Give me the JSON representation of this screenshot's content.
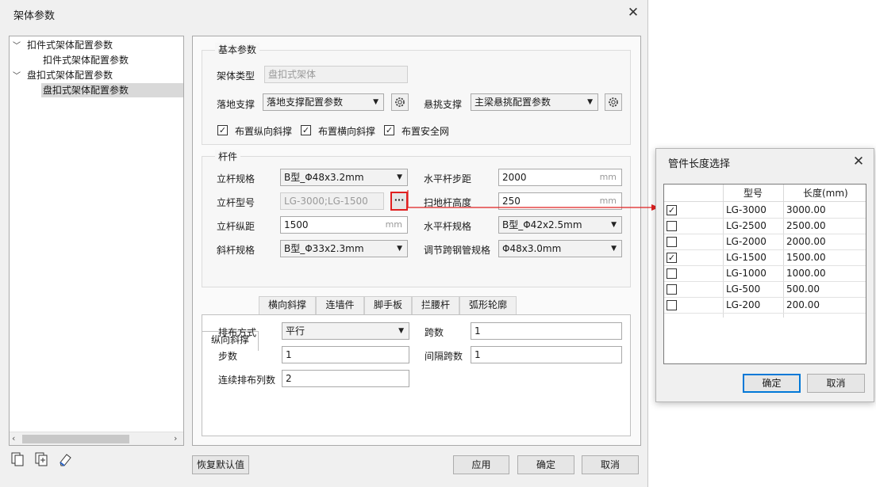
{
  "window": {
    "title": "架体参数"
  },
  "tree": {
    "items": [
      {
        "label": "扣件式架体配置参数",
        "expanded": true
      },
      {
        "label": "扣件式架体配置参数"
      },
      {
        "label": "盘扣式架体配置参数",
        "expanded": true
      },
      {
        "label": "盘扣式架体配置参数",
        "selected": true
      }
    ]
  },
  "basic": {
    "group_title": "基本参数",
    "frame_type_label": "架体类型",
    "frame_type_value": "盘扣式架体",
    "ground_support_label": "落地支撑",
    "ground_support_value": "落地支撑配置参数",
    "cantilever_label": "悬挑支撑",
    "cantilever_value": "主梁悬挑配置参数",
    "checks": [
      {
        "label": "布置纵向斜撑",
        "checked": true
      },
      {
        "label": "布置横向斜撑",
        "checked": true
      },
      {
        "label": "布置安全网",
        "checked": true
      }
    ]
  },
  "members": {
    "group_title": "杆件",
    "pole_spec_label": "立杆规格",
    "pole_spec_value": "B型_Φ48x3.2mm",
    "pole_model_label": "立杆型号",
    "pole_model_value": "LG-3000;LG-1500",
    "pole_model_button": "···",
    "pole_spacing_label": "立杆纵距",
    "pole_spacing_value": "1500",
    "diag_spec_label": "斜杆规格",
    "diag_spec_value": "B型_Φ33x2.3mm",
    "hstep_label": "水平杆步距",
    "hstep_value": "2000",
    "sweep_label": "扫地杆高度",
    "sweep_value": "250",
    "hspec_label": "水平杆规格",
    "hspec_value": "B型_Φ42x2.5mm",
    "adjust_label": "调节跨钢管规格",
    "adjust_value": "Φ48x3.0mm",
    "unit": "mm"
  },
  "tabs": [
    {
      "label": "纵向斜撑",
      "active": true
    },
    {
      "label": "横向斜撑"
    },
    {
      "label": "连墙件"
    },
    {
      "label": "脚手板"
    },
    {
      "label": "拦腰杆"
    },
    {
      "label": "弧形轮廓"
    }
  ],
  "tab_content": {
    "layout_label": "排布方式",
    "layout_value": "平行",
    "span_label": "跨数",
    "span_value": "1",
    "steps_label": "步数",
    "steps_value": "1",
    "gap_label": "间隔跨数",
    "gap_value": "1",
    "cols_label": "连续排布列数",
    "cols_value": "2"
  },
  "footer": {
    "restore": "恢复默认值",
    "apply": "应用",
    "ok": "确定",
    "cancel": "取消"
  },
  "dialog": {
    "title": "管件长度选择",
    "col_model": "型号",
    "col_length": "长度(mm)",
    "rows": [
      {
        "model": "LG-3000",
        "length": "3000.00",
        "checked": true
      },
      {
        "model": "LG-2500",
        "length": "2500.00",
        "checked": false
      },
      {
        "model": "LG-2000",
        "length": "2000.00",
        "checked": false
      },
      {
        "model": "LG-1500",
        "length": "1500.00",
        "checked": true
      },
      {
        "model": "LG-1000",
        "length": "1000.00",
        "checked": false
      },
      {
        "model": "LG-500",
        "length": "500.00",
        "checked": false
      },
      {
        "model": "LG-200",
        "length": "200.00",
        "checked": false
      }
    ],
    "ok": "确定",
    "cancel": "取消"
  },
  "colors": {
    "accent": "#0078d7",
    "highlight_red": "#e02020",
    "selected_row": "#d9d9d9"
  }
}
